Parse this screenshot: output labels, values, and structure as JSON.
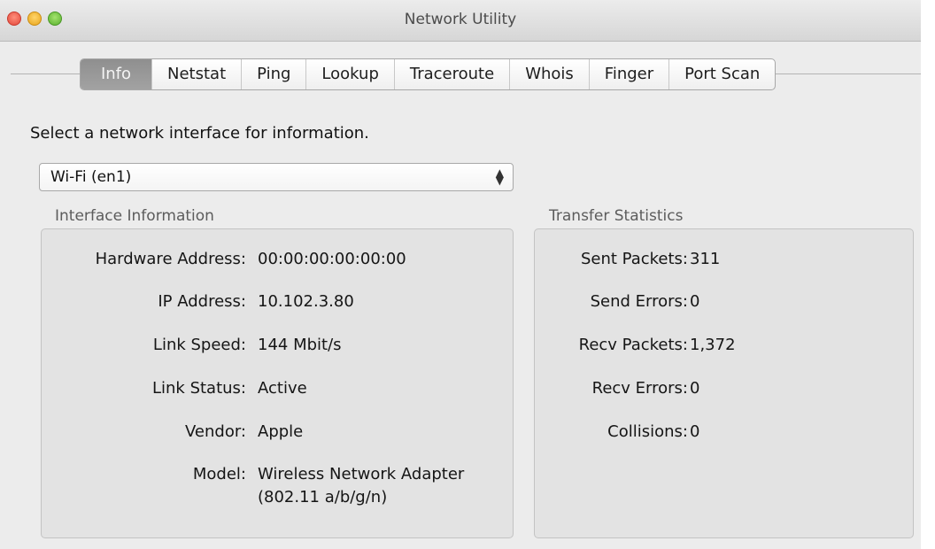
{
  "window": {
    "title": "Network Utility"
  },
  "tabs": [
    "Info",
    "Netstat",
    "Ping",
    "Lookup",
    "Traceroute",
    "Whois",
    "Finger",
    "Port Scan"
  ],
  "active_tab": "Info",
  "prompt": "Select a network interface for information.",
  "interface_select": {
    "value": "Wi-Fi (en1)"
  },
  "interface_info": {
    "heading": "Interface Information",
    "rows": [
      {
        "label": "Hardware Address:",
        "value": "00:00:00:00:00:00"
      },
      {
        "label": "IP Address:",
        "value": "10.102.3.80"
      },
      {
        "label": "Link Speed:",
        "value": "144 Mbit/s"
      },
      {
        "label": "Link Status:",
        "value": "Active"
      },
      {
        "label": "Vendor:",
        "value": "Apple"
      },
      {
        "label": "Model:",
        "value": "Wireless Network Adapter",
        "value2": "(802.11 a/b/g/n)"
      }
    ]
  },
  "transfer_stats": {
    "heading": "Transfer Statistics",
    "rows": [
      {
        "label": "Sent Packets:",
        "value": "311"
      },
      {
        "label": "Send Errors:",
        "value": "0"
      },
      {
        "label": "Recv Packets:",
        "value": "1,372"
      },
      {
        "label": "Recv Errors:",
        "value": "0"
      },
      {
        "label": "Collisions:",
        "value": "0"
      }
    ]
  }
}
